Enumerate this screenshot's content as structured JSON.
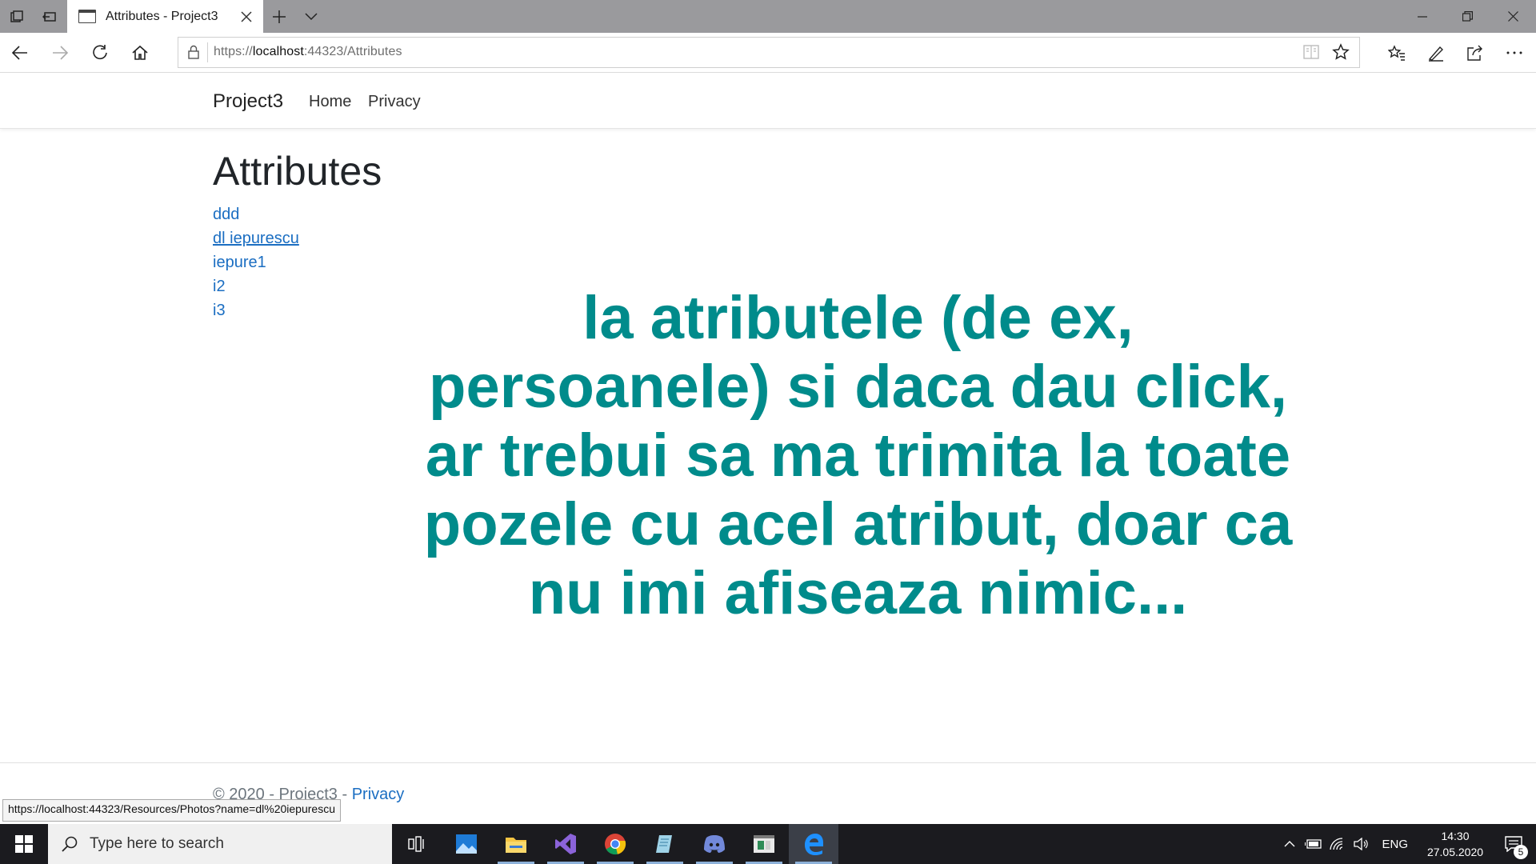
{
  "browser": {
    "tab_title": "Attributes - Project3",
    "url_prefix": "https://",
    "url_host": "localhost",
    "url_rest": ":44323/Attributes"
  },
  "site": {
    "brand": "Project3",
    "nav": [
      "Home",
      "Privacy"
    ]
  },
  "main": {
    "title": "Attributes",
    "attributes": [
      "ddd",
      "dl iepurescu",
      "iepure1",
      "i2",
      "i3"
    ],
    "hovered_index": 1,
    "overlay_text": "la atributele (de ex, persoanele) si daca dau click, ar trebui sa ma trimita la toate pozele cu acel atribut, doar ca nu imi afiseaza nimic...",
    "overlay_color": "#008b8b"
  },
  "footer": {
    "text": "© 2020 - Project3 - ",
    "link": "Privacy"
  },
  "status_bar": {
    "url": "https://localhost:44323/Resources/Photos?name=dl%20iepurescu"
  },
  "taskbar": {
    "search_placeholder": "Type here to search",
    "language": "ENG",
    "time": "14:30",
    "date": "27.05.2020",
    "notification_count": "5",
    "apps": [
      "task-view-icon",
      "photos-icon",
      "file-explorer-icon",
      "visual-studio-icon",
      "chrome-icon",
      "notepad-icon",
      "discord-icon",
      "sql-icon",
      "edge-icon"
    ]
  },
  "colors": {
    "link": "#1b6ec2",
    "tab_strip": "#9a9a9d",
    "taskbar": "#1b1b1f"
  }
}
